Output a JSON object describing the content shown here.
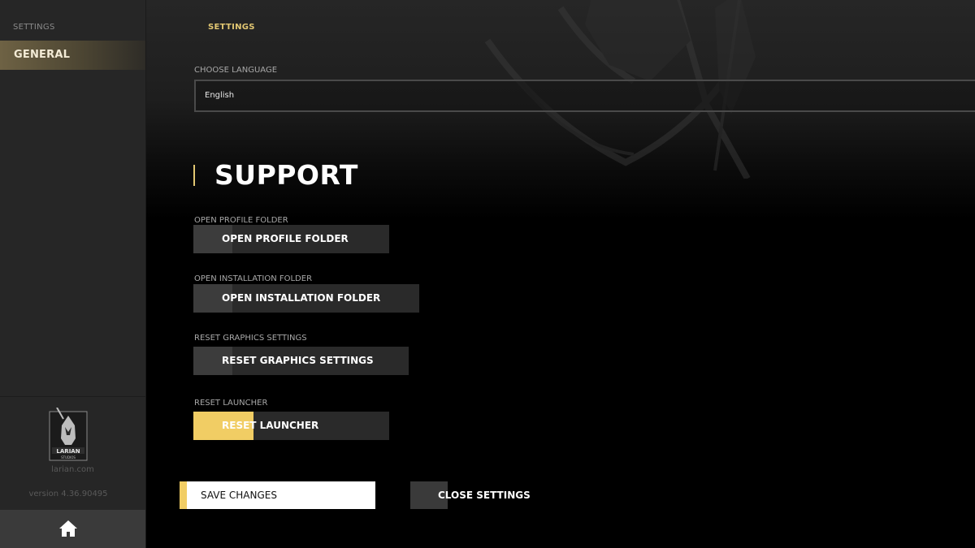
{
  "sidebar": {
    "title": "SETTINGS",
    "nav": [
      {
        "label": "GENERAL",
        "active": true
      }
    ],
    "link": "larian.com",
    "version": "version 4.36.90495",
    "home_icon": "home-icon",
    "logo_icon": "larian-studios-logo",
    "logo_text": "LARIAN STUDIOS"
  },
  "main": {
    "header_title": "SETTINGS",
    "language": {
      "label": "CHOOSE LANGUAGE",
      "value": "English"
    },
    "support": {
      "title": "SUPPORT",
      "rows": [
        {
          "label": "OPEN PROFILE FOLDER",
          "button": "OPEN PROFILE FOLDER"
        },
        {
          "label": "OPEN INSTALLATION FOLDER",
          "button": "OPEN INSTALLATION FOLDER"
        },
        {
          "label": "RESET GRAPHICS SETTINGS",
          "button": "RESET GRAPHICS SETTINGS"
        },
        {
          "label": "RESET LAUNCHER",
          "button": "RESET LAUNCHER"
        }
      ]
    },
    "save_label": "SAVE CHANGES",
    "close_label": "CLOSE SETTINGS"
  },
  "colors": {
    "accent": "#f1cd64",
    "header_gold": "#e2c772",
    "sidebar_bg": "#262626",
    "main_bg": "#000000"
  }
}
